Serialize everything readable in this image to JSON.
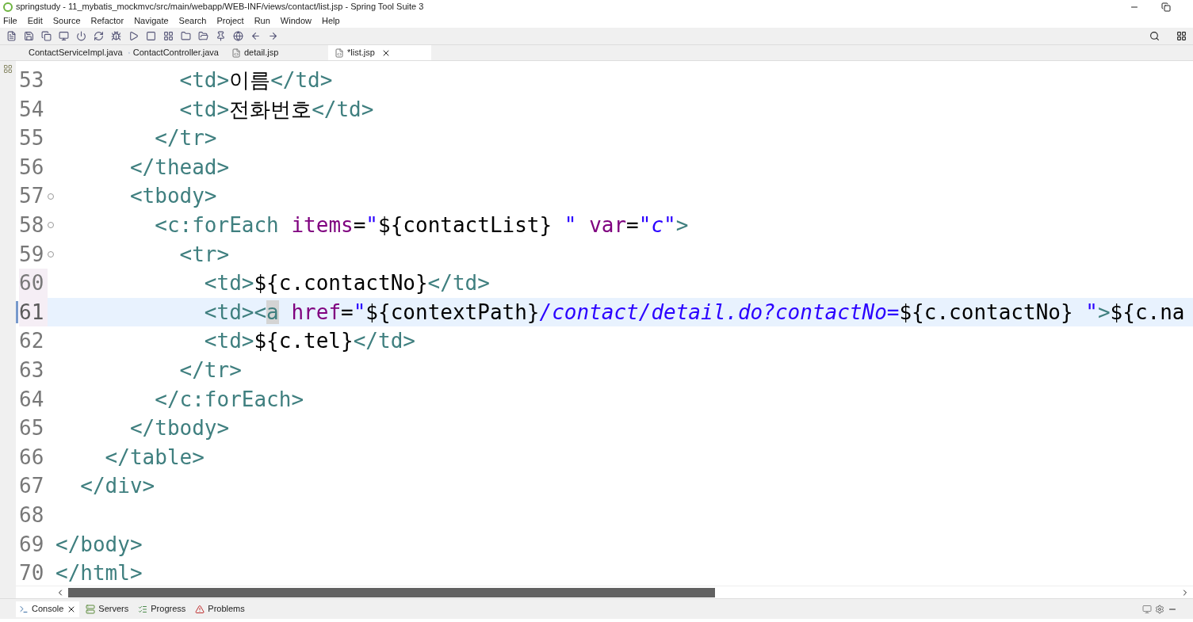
{
  "window": {
    "title": "springstudy - 11_mybatis_mockmvc/src/main/webapp/WEB-INF/views/contact/list.jsp - Spring Tool Suite 3"
  },
  "menu": [
    "File",
    "Edit",
    "Source",
    "Refactor",
    "Navigate",
    "Search",
    "Project",
    "Run",
    "Window",
    "Help"
  ],
  "editor_tabs": [
    {
      "label": "ContactServiceImpl.java",
      "kind": "java",
      "selected": false
    },
    {
      "label": "ContactController.java",
      "kind": "java",
      "selected": false
    },
    {
      "label": "detail.jsp",
      "kind": "jsp",
      "selected": false
    },
    {
      "label": "*list.jsp",
      "kind": "jsp",
      "selected": true
    }
  ],
  "code_lines": [
    {
      "number": "53",
      "changed": false,
      "foldable": false,
      "current": false,
      "tokens": [
        {
          "kind": "tag",
          "text": "          <td>"
        },
        {
          "kind": "text",
          "text": "이름"
        },
        {
          "kind": "tag",
          "text": "</td>"
        }
      ]
    },
    {
      "number": "54",
      "changed": false,
      "foldable": false,
      "current": false,
      "tokens": [
        {
          "kind": "tag",
          "text": "          <td>"
        },
        {
          "kind": "text",
          "text": "전화번호"
        },
        {
          "kind": "tag",
          "text": "</td>"
        }
      ]
    },
    {
      "number": "55",
      "changed": false,
      "foldable": false,
      "current": false,
      "tokens": [
        {
          "kind": "tag",
          "text": "        </tr>"
        }
      ]
    },
    {
      "number": "56",
      "changed": false,
      "foldable": false,
      "current": false,
      "tokens": [
        {
          "kind": "tag",
          "text": "      </thead>"
        }
      ]
    },
    {
      "number": "57",
      "changed": false,
      "foldable": true,
      "current": false,
      "tokens": [
        {
          "kind": "tag",
          "text": "      <tbody>"
        }
      ]
    },
    {
      "number": "58",
      "changed": false,
      "foldable": true,
      "current": false,
      "tokens": [
        {
          "kind": "tag",
          "text": "        <c:forEach "
        },
        {
          "kind": "attr",
          "text": "items"
        },
        {
          "kind": "text",
          "text": "="
        },
        {
          "kind": "value",
          "text": "\""
        },
        {
          "kind": "text",
          "text": "${contactList}"
        },
        {
          "kind": "value",
          "text": " \""
        },
        {
          "kind": "attr",
          "text": " var"
        },
        {
          "kind": "text",
          "text": "="
        },
        {
          "kind": "value",
          "text": "\"c\""
        },
        {
          "kind": "tag",
          "text": ">"
        }
      ]
    },
    {
      "number": "59",
      "changed": false,
      "foldable": true,
      "current": false,
      "tokens": [
        {
          "kind": "tag",
          "text": "          <tr>"
        }
      ]
    },
    {
      "number": "60",
      "changed": true,
      "foldable": false,
      "current": false,
      "tokens": [
        {
          "kind": "tag",
          "text": "            <td>"
        },
        {
          "kind": "text",
          "text": "${c.contactNo}"
        },
        {
          "kind": "tag",
          "text": "</td>"
        }
      ]
    },
    {
      "number": "61",
      "changed": true,
      "foldable": false,
      "current": true,
      "tokens": [
        {
          "kind": "tag",
          "text": "            <td><"
        },
        {
          "kind": "match",
          "text": "a"
        },
        {
          "kind": "attr",
          "text": " href"
        },
        {
          "kind": "text",
          "text": "="
        },
        {
          "kind": "value",
          "text": "\""
        },
        {
          "kind": "text",
          "text": "${contextPath}"
        },
        {
          "kind": "value",
          "text": "/contact/detail.do?contactNo="
        },
        {
          "kind": "text",
          "text": "${c.contactNo}"
        },
        {
          "kind": "value",
          "text": " \""
        },
        {
          "kind": "tag",
          "text": ">"
        },
        {
          "kind": "text",
          "text": "${c.na"
        }
      ]
    },
    {
      "number": "62",
      "changed": false,
      "foldable": false,
      "current": false,
      "tokens": [
        {
          "kind": "tag",
          "text": "            <td>"
        },
        {
          "kind": "text",
          "text": "${c.tel}"
        },
        {
          "kind": "tag",
          "text": "</td>"
        }
      ]
    },
    {
      "number": "63",
      "changed": false,
      "foldable": false,
      "current": false,
      "tokens": [
        {
          "kind": "tag",
          "text": "          </tr>"
        }
      ]
    },
    {
      "number": "64",
      "changed": false,
      "foldable": false,
      "current": false,
      "tokens": [
        {
          "kind": "tag",
          "text": "        </c:forEach>"
        }
      ]
    },
    {
      "number": "65",
      "changed": false,
      "foldable": false,
      "current": false,
      "tokens": [
        {
          "kind": "tag",
          "text": "      </tbody>"
        }
      ]
    },
    {
      "number": "66",
      "changed": false,
      "foldable": false,
      "current": false,
      "tokens": [
        {
          "kind": "tag",
          "text": "    </table>"
        }
      ]
    },
    {
      "number": "67",
      "changed": false,
      "foldable": false,
      "current": false,
      "tokens": [
        {
          "kind": "tag",
          "text": "  </div>"
        }
      ]
    },
    {
      "number": "68",
      "changed": false,
      "foldable": false,
      "current": false
    },
    {
      "number": "69",
      "changed": false,
      "foldable": false,
      "current": false,
      "tokens": [
        {
          "kind": "tag",
          "text": "</body>"
        }
      ]
    },
    {
      "number": "70",
      "changed": false,
      "foldable": false,
      "current": false,
      "tokens": [
        {
          "kind": "tag",
          "text": "</html>"
        }
      ]
    }
  ],
  "bottom_tabs": [
    {
      "label": "Console",
      "kind": "console",
      "selected": true
    },
    {
      "label": "Servers",
      "kind": "servers",
      "selected": false
    },
    {
      "label": "Progress",
      "kind": "progress",
      "selected": false
    },
    {
      "label": "Problems",
      "kind": "problems",
      "selected": false
    }
  ]
}
